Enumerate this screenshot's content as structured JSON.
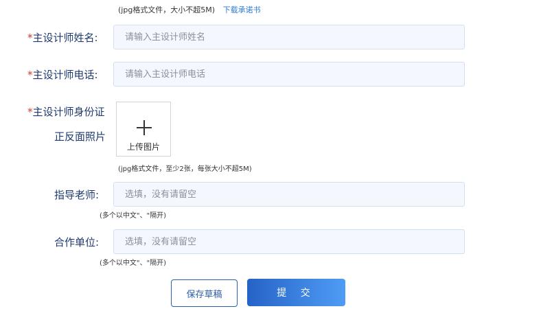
{
  "top_hint": {
    "text": "(jpg格式文件，大小不超5M)",
    "link": "下载承诺书"
  },
  "fields": {
    "designer_name": {
      "required_mark": "*",
      "label": "主设计师姓名:",
      "placeholder": "请输入主设计师姓名"
    },
    "designer_phone": {
      "required_mark": "*",
      "label": "主设计师电话:",
      "placeholder": "请输入主设计师电话"
    },
    "designer_id_photo": {
      "required_mark": "*",
      "label_line1": "主设计师身份证",
      "label_line2": "正反面照片",
      "upload_label": "上传图片",
      "hint": "(jpg格式文件，至少2张，每张大小不超5M)"
    },
    "advisor": {
      "label": "指导老师:",
      "placeholder": "选填，没有请留空",
      "hint": "(多个以中文\"、\"隔开)"
    },
    "partner": {
      "label": "合作单位:",
      "placeholder": "选填，没有请留空",
      "hint": "(多个以中文\"、\"隔开)"
    }
  },
  "buttons": {
    "save_draft": "保存草稿",
    "submit": "提 交"
  },
  "icons": {
    "upload": "plus-icon"
  },
  "colors": {
    "label": "#1e3a6e",
    "required": "#d63b2f",
    "link": "#2a7ad8",
    "submit_gradient_start": "#2563c6",
    "submit_gradient_end": "#4f9cf5"
  }
}
